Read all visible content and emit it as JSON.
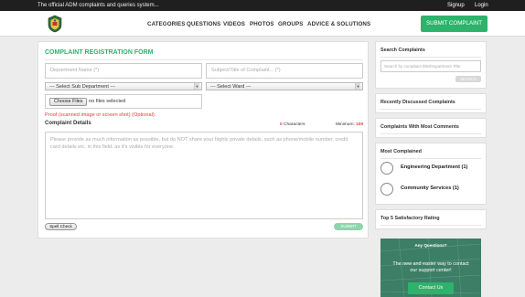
{
  "topbar": {
    "tagline": "The official ADM complaints and queries system...",
    "signup": "Signup",
    "login": "Login"
  },
  "nav": {
    "items": [
      "CATEGORIES",
      "QUESTIONS",
      "VIDEOS",
      "PHOTOS",
      "GROUPS",
      "ADVICE & SOLUTIONS"
    ],
    "submit": "SUBMIT COMPLAINT"
  },
  "form": {
    "title": "COMPLAINT REGISTRATION FORM",
    "department_placeholder": "Department Name (*)",
    "subject_placeholder": "Subject/Title of Complaint... (*)",
    "sub_department": "--- Select Sub Department ---",
    "ward": "--- Select Ward ---",
    "choose_files": "Choose Files",
    "no_files": "no files selected",
    "proof_note": "Proof (scanned image or screen shot) (Optional):",
    "details_label": "Complaint Details",
    "char_count": "0",
    "char_label": "Characters",
    "min_label": "Minimum:",
    "min_value": "100",
    "details_placeholder": "Please provide as much information as possible, but do NOT share your highly private details, such as phone/mobile number, credit card details etc. in this field, as it's visible for everyone.",
    "spell_check": "Spell Check",
    "submit": "SUBMIT"
  },
  "sidebar": {
    "search_title": "Search Complaints",
    "search_placeholder": "Search by complaint title/Department Title",
    "search_button": "SEARCH",
    "recent_title": "Recently Discussed Complaints",
    "most_comments_title": "Complaints With Most Comments",
    "most_complained_title": "Most Complained",
    "most_complained": [
      "Engineering Department (1)",
      "Community Services (1)"
    ],
    "satisfactory_title": "Top 5 Satisfactory Rating",
    "support_question": "Any Questions?",
    "support_text_1": "The new and easier way to contact",
    "support_text_2": "our support center!",
    "support_button": "Contact Us"
  },
  "colors": {
    "accent": "#2db36b",
    "topbar": "#1f1f1f",
    "error": "#e23b3b"
  }
}
